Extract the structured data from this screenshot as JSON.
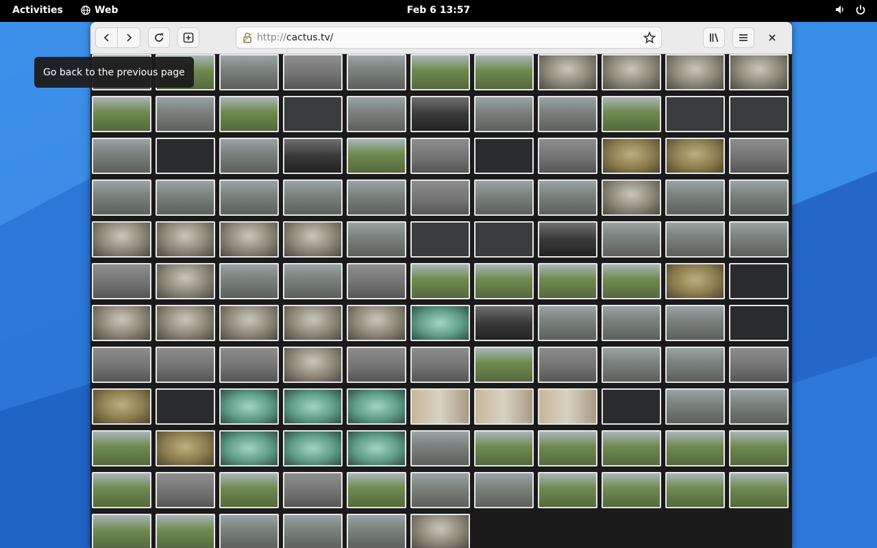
{
  "topbar": {
    "activities": "Activities",
    "app_name": "Web",
    "clock": "Feb 6  13:57"
  },
  "browser": {
    "url_scheme": "http://",
    "url_host": "cactus.tv/",
    "tooltip": "Go back to the previous page"
  },
  "camera_grid": {
    "columns": 11,
    "tiles": [
      "outdoor",
      "green",
      "outdoor",
      "gray",
      "outdoor",
      "green",
      "green",
      "indoor",
      "indoor",
      "indoor",
      "indoor",
      "green",
      "outdoor",
      "green",
      "dim",
      "outdoor",
      "dusk",
      "outdoor",
      "outdoor",
      "green",
      "dim",
      "dim",
      "outdoor",
      "dark",
      "outdoor",
      "dusk",
      "green",
      "gray",
      "dark",
      "gray",
      "lobby",
      "lobby",
      "gray",
      "outdoor",
      "outdoor",
      "outdoor",
      "outdoor",
      "outdoor",
      "gray",
      "outdoor",
      "outdoor",
      "indoor",
      "outdoor",
      "outdoor",
      "indoor",
      "indoor",
      "indoor",
      "indoor",
      "outdoor",
      "dim",
      "dim",
      "dusk",
      "outdoor",
      "outdoor",
      "outdoor",
      "gray",
      "indoor",
      "outdoor",
      "outdoor",
      "gray",
      "green",
      "green",
      "green",
      "green",
      "lobby",
      "dark",
      "indoor",
      "indoor",
      "indoor",
      "indoor",
      "indoor",
      "teal",
      "dusk",
      "outdoor",
      "outdoor",
      "outdoor",
      "dark",
      "gray",
      "gray",
      "gray",
      "indoor",
      "gray",
      "gray",
      "green",
      "gray",
      "outdoor",
      "outdoor",
      "gray",
      "lobby",
      "dark",
      "teal",
      "teal",
      "teal",
      "bldg",
      "bldg",
      "bldg",
      "dark",
      "outdoor",
      "outdoor",
      "green",
      "lobby",
      "teal",
      "teal",
      "teal",
      "outdoor",
      "green",
      "green",
      "green",
      "green",
      "green",
      "green",
      "gray",
      "green",
      "gray",
      "green",
      "outdoor",
      "outdoor",
      "green",
      "green",
      "green",
      "green",
      "green",
      "green",
      "outdoor",
      "outdoor",
      "outdoor",
      "indoor"
    ]
  }
}
